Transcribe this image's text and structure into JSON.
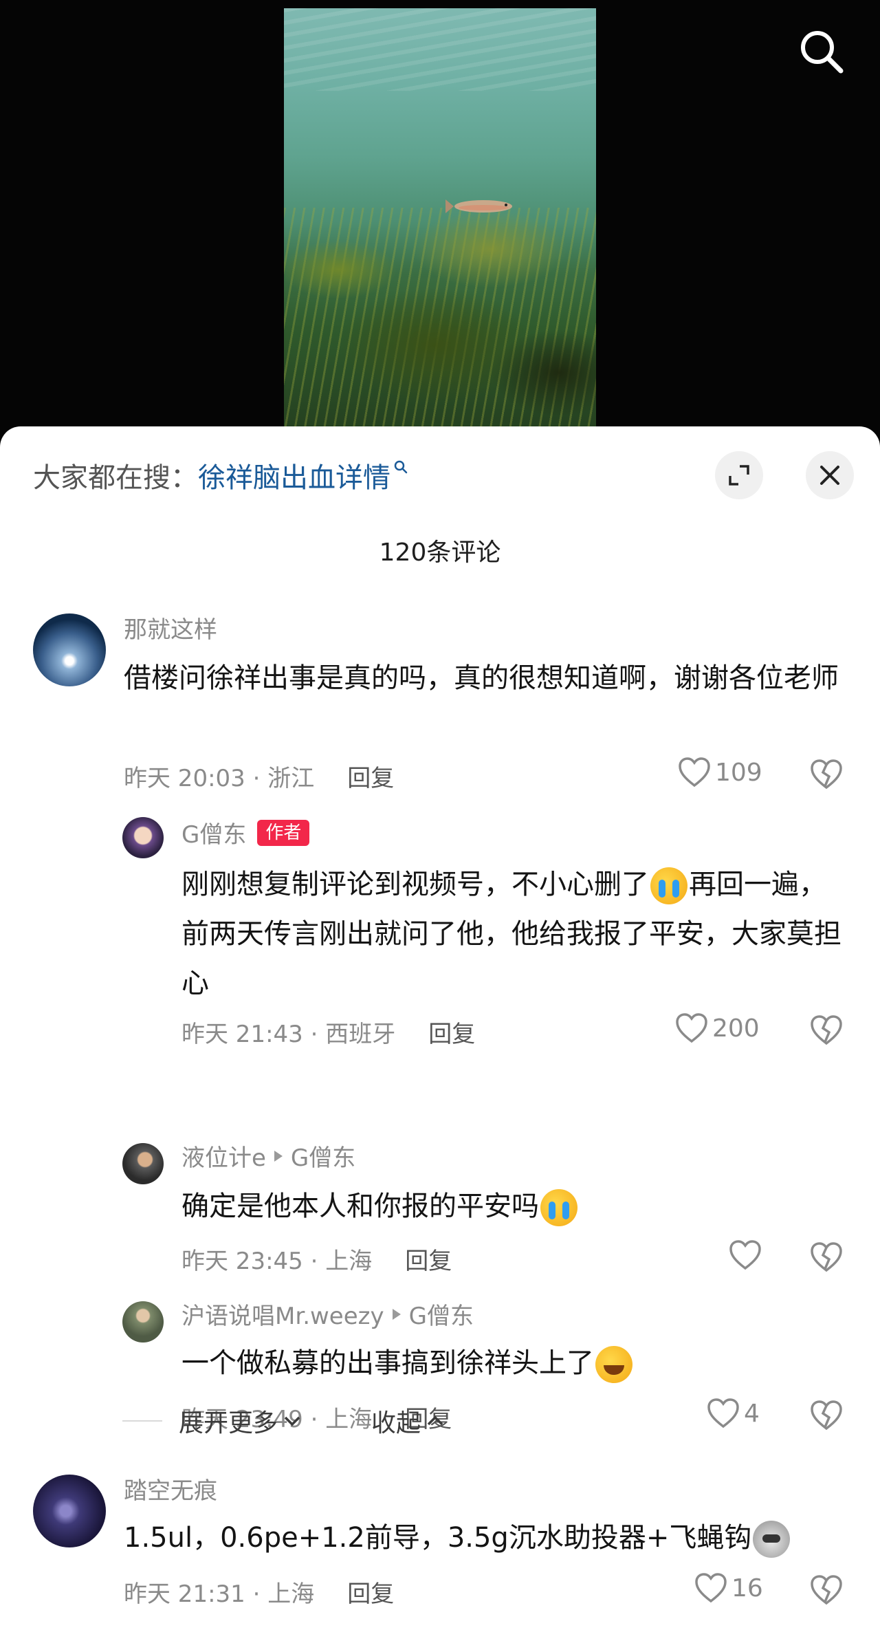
{
  "search": {
    "label": "大家都在搜：",
    "hot_query": "徐祥脑出血详情"
  },
  "comments_title": "120条评论",
  "comments": [
    {
      "name": "那就这样",
      "text": "借楼问徐祥出事是真的吗，真的很想知道啊，谢谢各位老师",
      "time": "昨天 20:03 · 浙江",
      "reply": "回复",
      "likes": "109"
    },
    {
      "name": "G僧东",
      "badge": "作者",
      "text_a": "刚刚想复制评论到视频号，不小心删了",
      "text_b": "再回一遍，前两天传言刚出就问了他，他给我报了平安，大家莫担心",
      "time": "昨天 21:43 · 西班牙",
      "reply": "回复",
      "likes": "200"
    },
    {
      "name": "液位计e",
      "reply_to": "G僧东",
      "text": "确定是他本人和你报的平安吗",
      "time": "昨天 23:45 · 上海",
      "reply": "回复",
      "likes": ""
    },
    {
      "name": "沪语说唱Mr.weezy",
      "reply_to": "G僧东",
      "text": "一个做私募的出事搞到徐祥头上了",
      "time": "昨天 23:49 · 上海",
      "reply": "回复",
      "likes": "4"
    },
    {
      "name": "踏空无痕",
      "text": "1.5ul，0.6pe+1.2前导，3.5g沉水助投器+飞蝇钩",
      "time": "昨天 21:31 · 上海",
      "reply": "回复",
      "likes": "16"
    }
  ],
  "thread_controls": {
    "expand_more": "展开更多",
    "collapse": "收起"
  },
  "icons": {
    "search": "search-icon",
    "expand": "expand-icon",
    "close": "close-icon",
    "like": "heart-outline-icon",
    "dislike": "broken-heart-icon"
  },
  "colors": {
    "hot_search_link": "#1a5a98",
    "author_badge": "#f2274a",
    "meta_text": "#8a8a8a"
  }
}
